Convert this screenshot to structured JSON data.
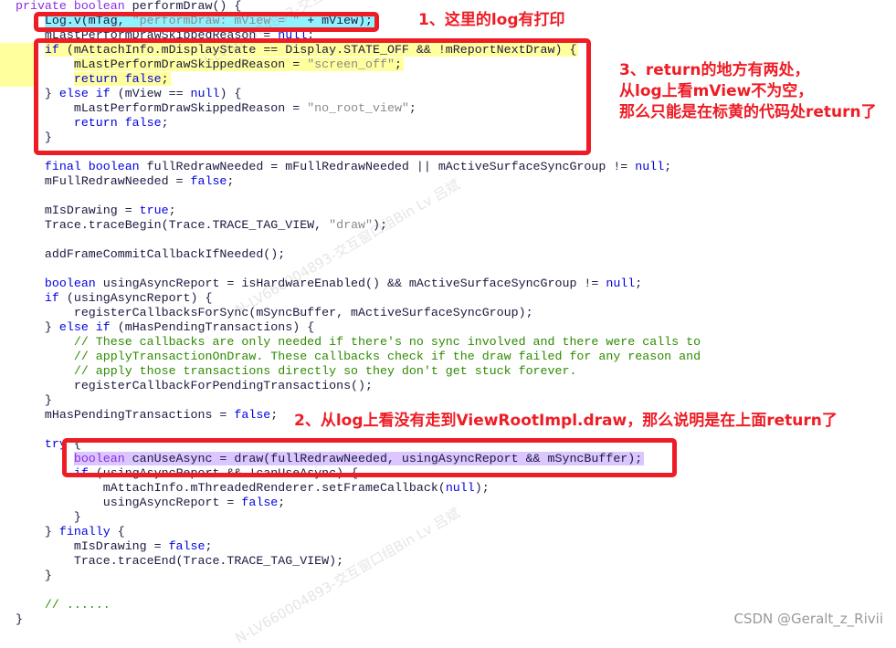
{
  "code_lines": [
    {
      "tokens": [
        [
          "private boolean ",
          "kw2"
        ],
        [
          "performDraw() {",
          "plain"
        ]
      ]
    },
    {
      "highlight": "cyan",
      "indent": 1,
      "tokens": [
        [
          "Log.v(mTag, ",
          "plain"
        ],
        [
          "\"performDraw: mView = \"",
          "str"
        ],
        [
          " + mView);",
          "plain"
        ]
      ]
    },
    {
      "indent": 1,
      "tokens": [
        [
          "mLastPerformDrawSkippedReason = ",
          "plain"
        ],
        [
          "null",
          "kw"
        ],
        [
          ";",
          "plain"
        ]
      ]
    },
    {
      "highlight": "yellow",
      "gutter": true,
      "indent": 1,
      "tokens": [
        [
          "if",
          "kw"
        ],
        [
          " (mAttachInfo.mDisplayState == Display.STATE_OFF && !mReportNextDraw) {",
          "plain"
        ]
      ]
    },
    {
      "highlight": "yellow",
      "gutter": true,
      "indent": 2,
      "tokens": [
        [
          "mLastPerformDrawSkippedReason = ",
          "plain"
        ],
        [
          "\"screen_off\"",
          "str"
        ],
        [
          ";",
          "plain"
        ]
      ]
    },
    {
      "highlight": "yellow",
      "gutter": true,
      "indent": 2,
      "tokens": [
        [
          "return false",
          "kw"
        ],
        [
          ";",
          "plain"
        ]
      ]
    },
    {
      "indent": 1,
      "tokens": [
        [
          "} ",
          "plain"
        ],
        [
          "else if",
          "kw"
        ],
        [
          " (mView == ",
          "plain"
        ],
        [
          "null",
          "kw"
        ],
        [
          ") {",
          "plain"
        ]
      ]
    },
    {
      "indent": 2,
      "tokens": [
        [
          "mLastPerformDrawSkippedReason = ",
          "plain"
        ],
        [
          "\"no_root_view\"",
          "str"
        ],
        [
          ";",
          "plain"
        ]
      ]
    },
    {
      "indent": 2,
      "tokens": [
        [
          "return false",
          "kw"
        ],
        [
          ";",
          "plain"
        ]
      ]
    },
    {
      "indent": 1,
      "tokens": [
        [
          "}",
          "plain"
        ]
      ]
    },
    {
      "tokens": []
    },
    {
      "indent": 1,
      "tokens": [
        [
          "final boolean",
          "kw"
        ],
        [
          " fullRedrawNeeded = mFullRedrawNeeded || mActiveSurfaceSyncGroup != ",
          "plain"
        ],
        [
          "null",
          "kw"
        ],
        [
          ";",
          "plain"
        ]
      ]
    },
    {
      "indent": 1,
      "tokens": [
        [
          "mFullRedrawNeeded = ",
          "plain"
        ],
        [
          "false",
          "kw"
        ],
        [
          ";",
          "plain"
        ]
      ]
    },
    {
      "tokens": []
    },
    {
      "indent": 1,
      "tokens": [
        [
          "mIsDrawing = ",
          "plain"
        ],
        [
          "true",
          "kw"
        ],
        [
          ";",
          "plain"
        ]
      ]
    },
    {
      "indent": 1,
      "tokens": [
        [
          "Trace.traceBegin(Trace.TRACE_TAG_VIEW, ",
          "plain"
        ],
        [
          "\"draw\"",
          "str"
        ],
        [
          ");",
          "plain"
        ]
      ]
    },
    {
      "tokens": []
    },
    {
      "indent": 1,
      "tokens": [
        [
          "addFrameCommitCallbackIfNeeded();",
          "plain"
        ]
      ]
    },
    {
      "tokens": []
    },
    {
      "indent": 1,
      "tokens": [
        [
          "boolean",
          "kw"
        ],
        [
          " usingAsyncReport = isHardwareEnabled() && mActiveSurfaceSyncGroup != ",
          "plain"
        ],
        [
          "null",
          "kw"
        ],
        [
          ";",
          "plain"
        ]
      ]
    },
    {
      "indent": 1,
      "tokens": [
        [
          "if",
          "kw"
        ],
        [
          " (usingAsyncReport) {",
          "plain"
        ]
      ]
    },
    {
      "indent": 2,
      "tokens": [
        [
          "registerCallbacksForSync(mSyncBuffer, mActiveSurfaceSyncGroup);",
          "plain"
        ]
      ]
    },
    {
      "indent": 1,
      "tokens": [
        [
          "} ",
          "plain"
        ],
        [
          "else if",
          "kw"
        ],
        [
          " (mHasPendingTransactions) {",
          "plain"
        ]
      ]
    },
    {
      "indent": 2,
      "tokens": [
        [
          "// These callbacks are only needed if there's no sync involved and there were calls to",
          "cm"
        ]
      ]
    },
    {
      "indent": 2,
      "tokens": [
        [
          "// applyTransactionOnDraw. These callbacks check if the draw failed for any reason and",
          "cm"
        ]
      ]
    },
    {
      "indent": 2,
      "tokens": [
        [
          "// apply those transactions directly so they don't get stuck forever.",
          "cm"
        ]
      ]
    },
    {
      "indent": 2,
      "tokens": [
        [
          "registerCallbackForPendingTransactions();",
          "plain"
        ]
      ]
    },
    {
      "indent": 1,
      "tokens": [
        [
          "}",
          "plain"
        ]
      ]
    },
    {
      "indent": 1,
      "tokens": [
        [
          "mHasPendingTransactions = ",
          "plain"
        ],
        [
          "false",
          "kw"
        ],
        [
          ";",
          "plain"
        ]
      ]
    },
    {
      "tokens": []
    },
    {
      "indent": 1,
      "tokens": [
        [
          "try",
          "kw"
        ],
        [
          " {",
          "plain"
        ]
      ]
    },
    {
      "highlight": "purple",
      "indent": 2,
      "tokens": [
        [
          "boolean",
          "kw2"
        ],
        [
          " canUseAsync = draw(fullRedrawNeeded, usingAsyncReport && mSyncBuffer);",
          "plain"
        ]
      ]
    },
    {
      "indent": 2,
      "tokens": [
        [
          "if",
          "kw"
        ],
        [
          " (usingAsyncReport && !canUseAsync) {",
          "plain"
        ]
      ]
    },
    {
      "indent": 3,
      "tokens": [
        [
          "mAttachInfo.mThreadedRenderer.setFrameCallback(",
          "plain"
        ],
        [
          "null",
          "kw"
        ],
        [
          ");",
          "plain"
        ]
      ]
    },
    {
      "indent": 3,
      "tokens": [
        [
          "usingAsyncReport = ",
          "plain"
        ],
        [
          "false",
          "kw"
        ],
        [
          ";",
          "plain"
        ]
      ]
    },
    {
      "indent": 2,
      "tokens": [
        [
          "}",
          "plain"
        ]
      ]
    },
    {
      "indent": 1,
      "tokens": [
        [
          "} ",
          "plain"
        ],
        [
          "finally",
          "kw"
        ],
        [
          " {",
          "plain"
        ]
      ]
    },
    {
      "indent": 2,
      "tokens": [
        [
          "mIsDrawing = ",
          "plain"
        ],
        [
          "false",
          "kw"
        ],
        [
          ";",
          "plain"
        ]
      ]
    },
    {
      "indent": 2,
      "tokens": [
        [
          "Trace.traceEnd(Trace.TRACE_TAG_VIEW);",
          "plain"
        ]
      ]
    },
    {
      "indent": 1,
      "tokens": [
        [
          "}",
          "plain"
        ]
      ]
    },
    {
      "tokens": []
    },
    {
      "indent": 1,
      "tokens": [
        [
          "// ......",
          "cm"
        ]
      ]
    },
    {
      "tokens": [
        [
          "}",
          "plain"
        ]
      ]
    }
  ],
  "annotations": {
    "note1": "1、这里的log有打印",
    "note2": "2、从log上看没有走到ViewRootImpl.draw，那么说明是在上面return了",
    "note3_line1": "3、return的地方有两处，",
    "note3_line2": "从log上看mView不为空，",
    "note3_line3": "那么只能是在标黄的代码处return了"
  },
  "watermark": "N-LV660004893-交互窗口组Bin Lv 吕斌",
  "footer": "CSDN @Geralt_z_Rivii",
  "colors": {
    "annotation_red": "#ee1c25",
    "highlight_yellow": "#ffff9e",
    "highlight_cyan": "#8ff3ff",
    "highlight_purple": "#dcc6ff"
  }
}
